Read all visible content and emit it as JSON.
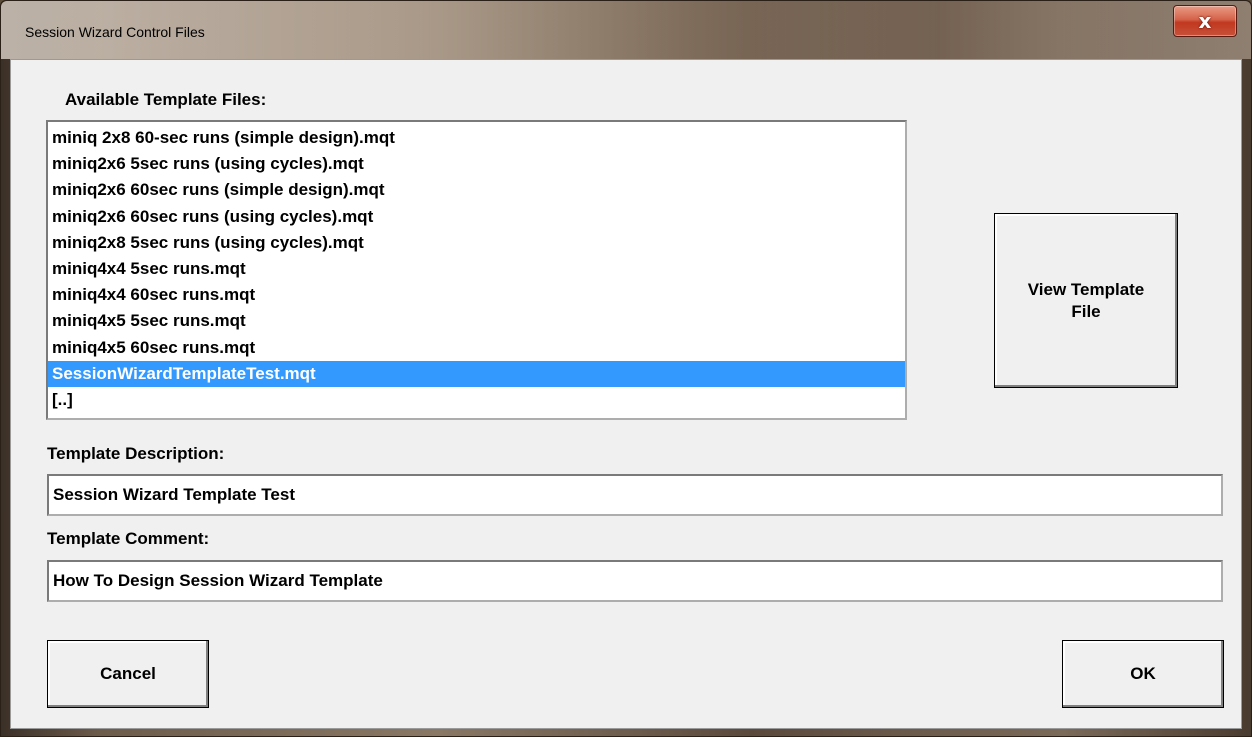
{
  "window": {
    "title": "Session Wizard Control Files",
    "close_glyph": "x"
  },
  "available": {
    "label": "Available Template Files:",
    "items": [
      "miniq 2x8 60-sec runs (simple design).mqt",
      "miniq2x6 5sec runs (using cycles).mqt",
      "miniq2x6 60sec runs (simple design).mqt",
      "miniq2x6 60sec runs (using cycles).mqt",
      "miniq2x8 5sec runs (using cycles).mqt",
      "miniq4x4 5sec runs.mqt",
      "miniq4x4 60sec runs.mqt",
      "miniq4x5 5sec runs.mqt",
      "miniq4x5 60sec runs.mqt",
      "SessionWizardTemplateTest.mqt",
      "[..]"
    ],
    "selected_index": 9
  },
  "view_button": {
    "line1": "View Template",
    "line2": "File"
  },
  "description": {
    "label": "Template Description:",
    "value": "Session Wizard Template Test"
  },
  "comment": {
    "label": "Template Comment:",
    "value": "How To Design Session Wizard Template"
  },
  "buttons": {
    "cancel": "Cancel",
    "ok": "OK"
  },
  "colors": {
    "selection": "#3399ff",
    "dialog_bg": "#f0f0f0",
    "close_button": "#c8513a"
  }
}
